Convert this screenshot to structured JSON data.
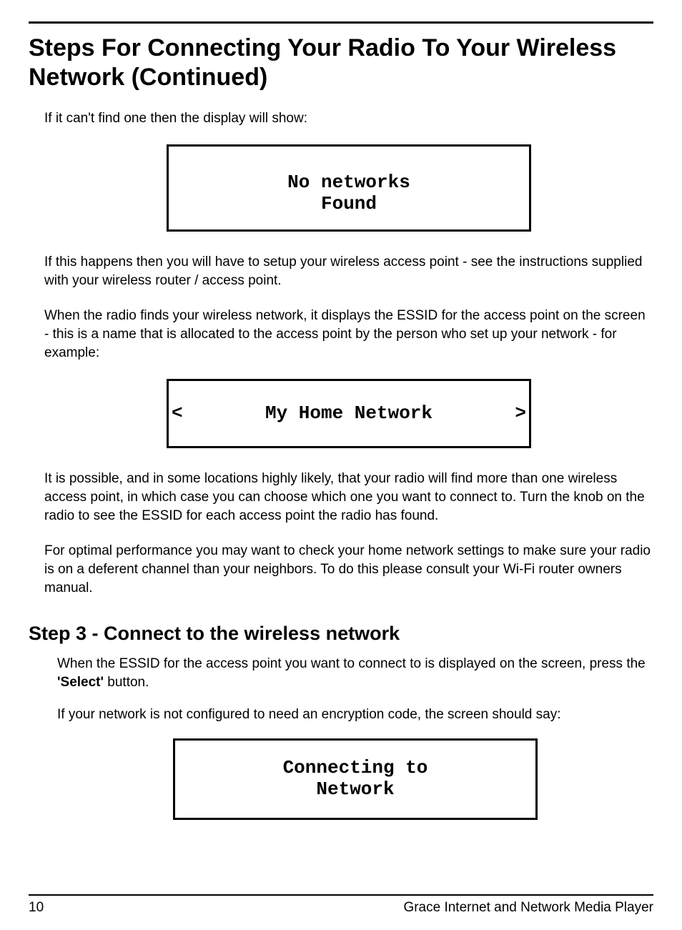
{
  "title": "Steps For Connecting Your Radio To Your Wireless Network (Continued)",
  "p1": "If it can't find one then the display will show:",
  "lcd1": {
    "line1": "No networks",
    "line2": "Found"
  },
  "p2": "If this happens then you will have to setup your wireless access point - see the instructions supplied with your wireless router / access point.",
  "p3": "When the radio finds your wireless network, it displays the ESSID for the access point on the screen - this is a name that is allocated to the access point by the person who set up your network - for example:",
  "lcd2": {
    "left": "<",
    "center": "My Home Network",
    "right": ">"
  },
  "p4": "It is possible, and in some locations highly likely, that your radio will find more than one wireless access point, in which case you can choose which one you want to connect to. Turn the knob on the radio to see the ESSID for each access point the radio has found.",
  "p5": "For optimal performance you may want to check your home network settings to make sure your radio is on a deferent channel than your neighbors. To do this please consult your Wi-Fi router owners manual.",
  "step3_heading": "Step 3 - Connect to the wireless network",
  "p6a": "When the ESSID for the access point you want to connect to is displayed on the screen, press the ",
  "p6b": "'Select'",
  "p6c": " button.",
  "p7": "If your network is not configured to need an encryption code, the screen should say:",
  "lcd3": {
    "line1": "Connecting to",
    "line2": "Network"
  },
  "footer": {
    "page_number": "10",
    "product": "Grace Internet and Network Media Player"
  }
}
